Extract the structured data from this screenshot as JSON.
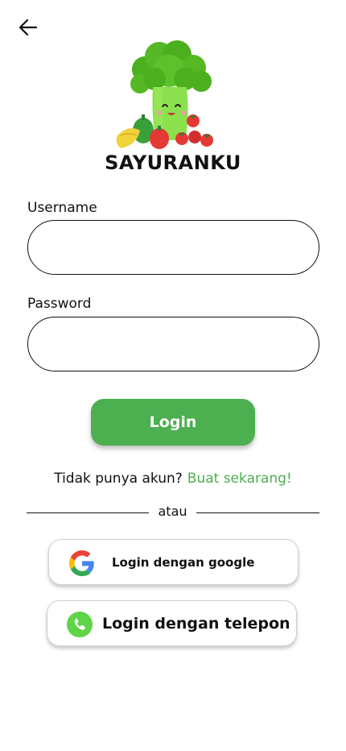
{
  "app": {
    "name": "SAYURANKU"
  },
  "form": {
    "username_label": "Username",
    "username_value": "",
    "password_label": "Password",
    "password_value": "",
    "login_label": "Login"
  },
  "signup": {
    "text": "Tidak punya akun?",
    "link": "Buat sekarang!"
  },
  "divider": {
    "text": "atau"
  },
  "social": {
    "google_label": "Login dengan google",
    "phone_label": "Login dengan telepon"
  },
  "colors": {
    "accent": "#4caf50",
    "text": "#111111",
    "background": "#ffffff"
  },
  "icons": {
    "back": "arrow-left-icon",
    "logo": "broccoli-vegetables-logo",
    "google": "google-icon",
    "phone": "phone-icon"
  }
}
